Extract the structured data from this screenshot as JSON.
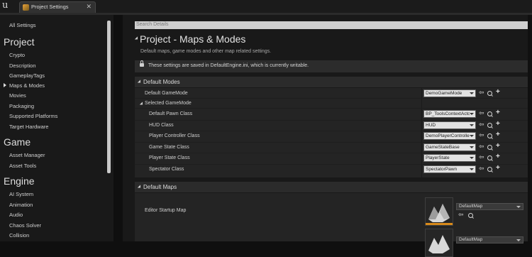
{
  "window": {
    "tab_label": "Project Settings",
    "logo_glyph": "u"
  },
  "sidebar": {
    "all_settings": "All Settings",
    "groups": [
      {
        "title": "Project",
        "items": [
          "Crypto",
          "Description",
          "GameplayTags",
          "Maps & Modes",
          "Movies",
          "Packaging",
          "Supported Platforms",
          "Target Hardware"
        ]
      },
      {
        "title": "Game",
        "items": [
          "Asset Manager",
          "Asset Tools"
        ]
      },
      {
        "title": "Engine",
        "items": [
          "AI System",
          "Animation",
          "Audio",
          "Chaos Solver",
          "Collision"
        ]
      }
    ],
    "selected": "Maps & Modes"
  },
  "main": {
    "search_placeholder": "Search Details",
    "title": "Project - Maps & Modes",
    "description": "Default maps, game modes and other map related settings.",
    "notice": "These settings are saved in DefaultEngine.ini, which is currently writable.",
    "sections": {
      "default_modes": "Default Modes",
      "default_maps": "Default Maps"
    },
    "modes": {
      "default_gamemode_label": "Default GameMode",
      "default_gamemode_value": "DemoGameMode",
      "selected_gamemode_label": "Selected GameMode",
      "rows": [
        {
          "label": "Default Pawn Class",
          "value": "BP_ToolsContextActor"
        },
        {
          "label": "HUD Class",
          "value": "HUD"
        },
        {
          "label": "Player Controller Class",
          "value": "DemoPlayerController"
        },
        {
          "label": "Game State Class",
          "value": "GameStateBase"
        },
        {
          "label": "Player State Class",
          "value": "PlayerState"
        },
        {
          "label": "Spectator Class",
          "value": "SpectatorPawn"
        }
      ]
    },
    "maps": {
      "editor_startup_label": "Editor Startup Map",
      "editor_startup_value": "DefaultMap",
      "second_value": "DefaultMap"
    }
  },
  "icons": [
    "unreal-logo-icon",
    "settings-tab-icon",
    "close-icon",
    "lock-icon",
    "use-selected-arrow-icon",
    "browse-icon",
    "add-icon",
    "chevron-down-icon",
    "map-thumbnail-icon"
  ]
}
